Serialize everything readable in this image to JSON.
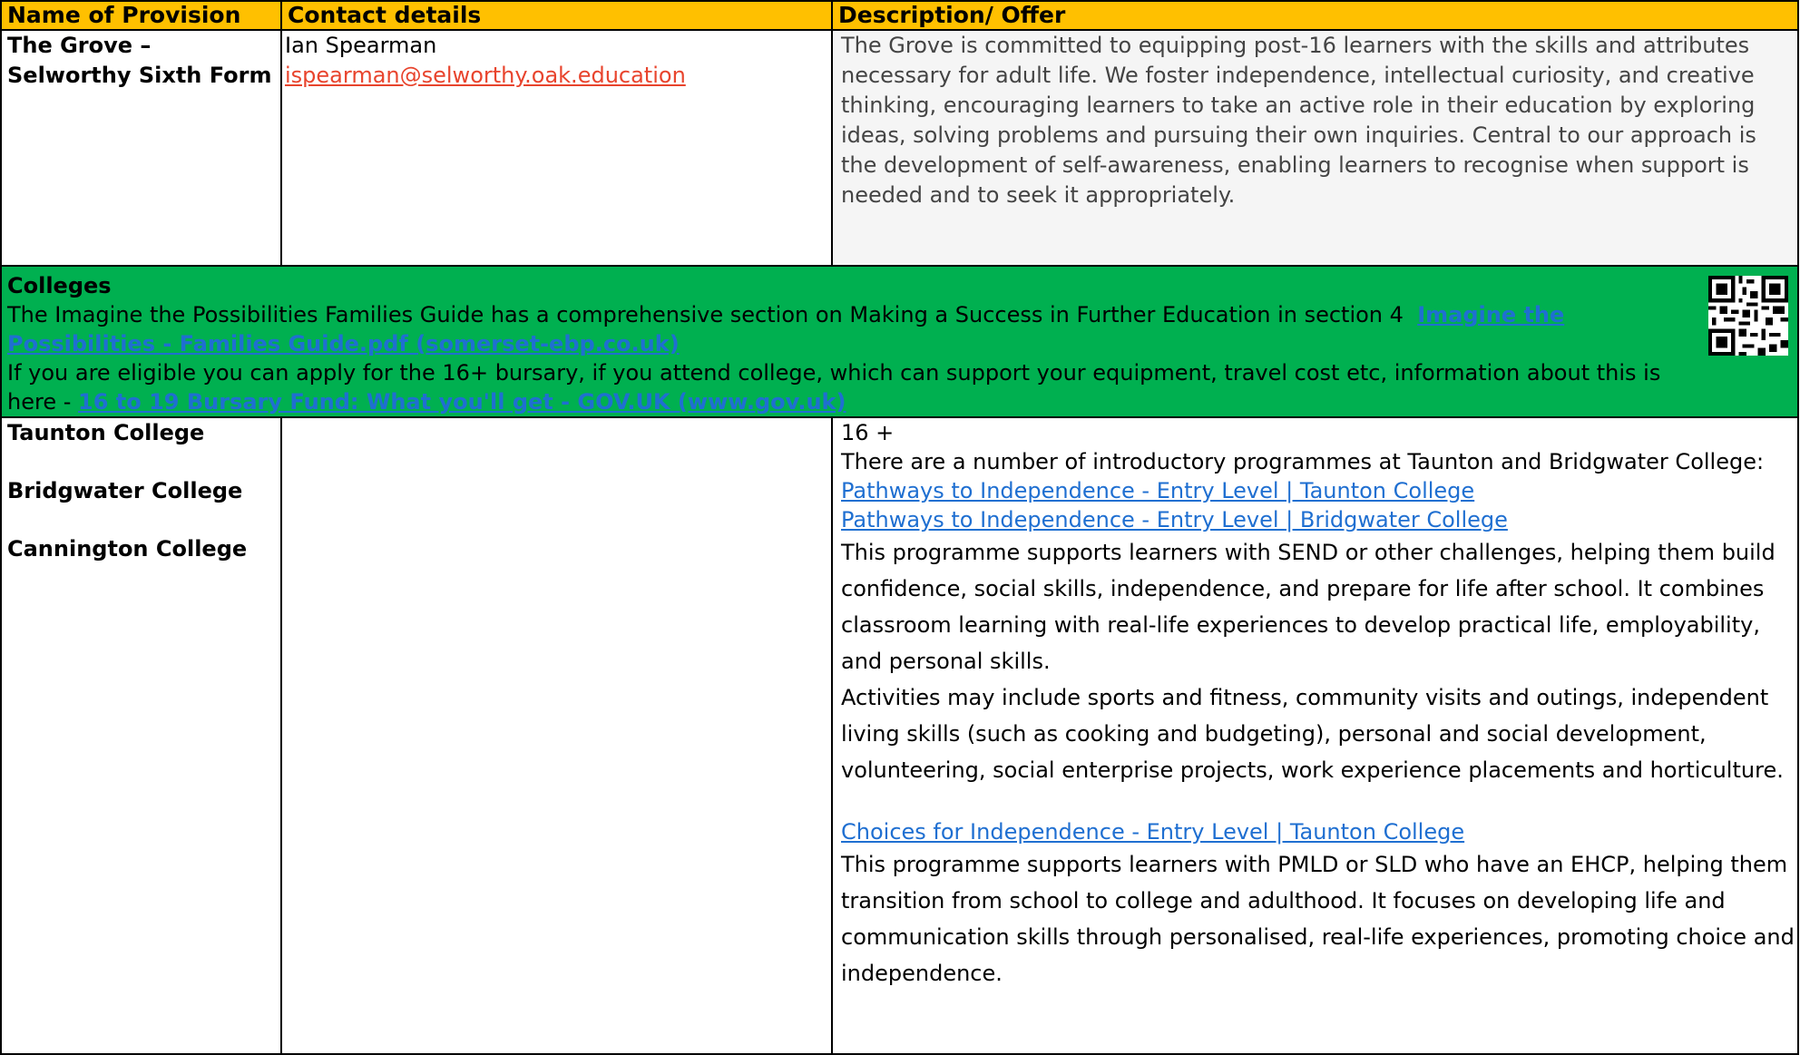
{
  "header": {
    "col1": "Name of Provision",
    "col2": "Contact details",
    "col3": "Description/ Offer"
  },
  "grove": {
    "name_line1": "The Grove –",
    "name_line2": "Selworthy Sixth Form",
    "contact_name": "Ian Spearman",
    "contact_email": "ispearman@selworthy.oak.education",
    "description": "The Grove is committed to equipping post-16 learners with the skills and attributes necessary for adult life. We foster independence, intellectual curiosity, and creative thinking, encouraging learners to take an active role in their education by exploring ideas, solving problems and pursuing their own inquiries. Central to our approach is the development of self-awareness, enabling learners to recognise when support is needed and to seek it appropriately."
  },
  "colleges_banner": {
    "title": "Colleges",
    "guide_text": "The Imagine the Possibilities Families Guide has a comprehensive section on Making a Success in Further Education in section 4",
    "guide_link": "Imagine the Possibilities - Families Guide.pdf (somerset-ebp.co.uk)",
    "bursary_text": "If you are eligible you can apply for the 16+ bursary, if you attend college, which can support your equipment, travel cost etc, information about this is here -",
    "bursary_link": "16 to 19 Bursary Fund: What you'll get - GOV.UK (www.gov.uk)",
    "qr_icon": "qr-code-icon"
  },
  "colleges": {
    "names": [
      "Taunton College",
      "Bridgwater College",
      "Cannington College"
    ],
    "age": "16 +",
    "intro": "There are a number of introductory programmes at Taunton and Bridgwater College:",
    "link1": "Pathways to Independence - Entry Level | Taunton College",
    "link2": "Pathways to Independence - Entry Level | Bridgwater College",
    "para1": "This programme supports learners with SEND or other challenges, helping them build confidence, social skills, independence, and prepare for life after school. It combines classroom learning with real-life experiences to develop practical life, employability, and personal skills.",
    "para2": "Activities may include sports and fitness, community visits and outings, independent living skills (such as cooking and budgeting), personal and social development, volunteering, social enterprise projects, work experience placements and horticulture.",
    "link3": "Choices for Independence - Entry Level | Taunton College",
    "para3": "This programme supports learners with PMLD or SLD who have an EHCP, helping them transition from school to college and adulthood. It focuses on developing life and communication skills through personalised, real-life experiences, promoting choice and independence."
  }
}
